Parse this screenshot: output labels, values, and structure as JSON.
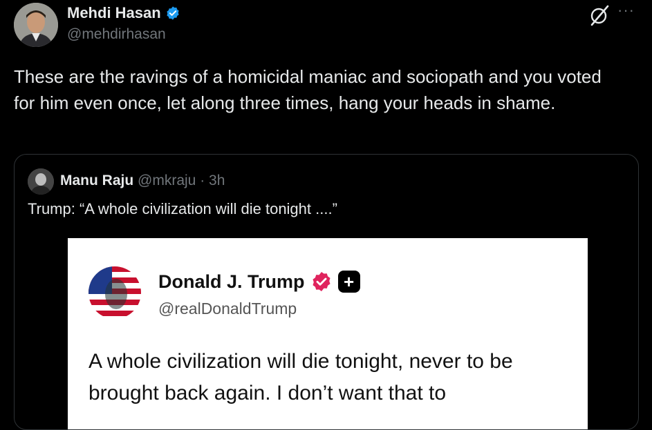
{
  "author": {
    "name": "Mehdi Hasan",
    "handle": "@mehdirhasan"
  },
  "header_actions": {
    "grok_icon": "grok-icon",
    "more_label": "···"
  },
  "tweet": {
    "text": "These are the ravings of a homicidal maniac and sociopath and you voted for him even once, let along three times, hang your heads in shame."
  },
  "quote": {
    "name": "Manu Raju",
    "handle": "@mkraju",
    "separator": "·",
    "time": "3h",
    "text": "Trump: “A whole civilization will die tonight ....”",
    "embed": {
      "name": "Donald J. Trump",
      "handle": "@realDonaldTrump",
      "plus_label": "+",
      "text": "A whole civilization will die tonight, never to be brought back again. I don’t want that to"
    }
  },
  "colors": {
    "background": "#000000",
    "text_primary": "#e7e9ea",
    "text_secondary": "#71767b",
    "verified_blue": "#1d9bf0",
    "verified_pink": "#e0245e",
    "border": "#2f3336"
  }
}
